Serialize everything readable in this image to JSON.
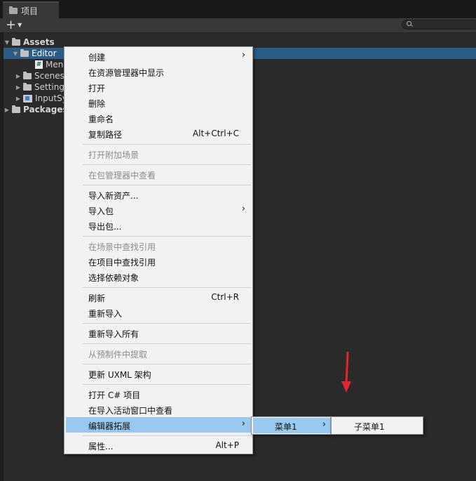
{
  "window": {
    "tab_label": "项目",
    "add_button": "+",
    "search_placeholder": ""
  },
  "tree": [
    {
      "label": "Assets",
      "expanded": true,
      "icon": "folder-icon"
    },
    {
      "label": "Editor",
      "expanded": true,
      "icon": "folder-open-icon",
      "selected": true
    },
    {
      "label": "Men",
      "icon": "csharp-script-icon"
    },
    {
      "label": "Scenes",
      "icon": "folder-icon"
    },
    {
      "label": "Setting",
      "icon": "folder-icon"
    },
    {
      "label": "InputSy",
      "icon": "input-settings-icon"
    },
    {
      "label": "Packages",
      "icon": "folder-icon"
    }
  ],
  "context_menu": {
    "items": [
      {
        "label": "创建",
        "submenu": true
      },
      {
        "label": "在资源管理器中显示"
      },
      {
        "label": "打开"
      },
      {
        "label": "删除"
      },
      {
        "label": "重命名"
      },
      {
        "label": "复制路径",
        "shortcut": "Alt+Ctrl+C"
      },
      {
        "label": "打开附加场景",
        "disabled": true
      },
      {
        "label": "在包管理器中查看",
        "disabled": true
      },
      {
        "label": "导入新资产..."
      },
      {
        "label": "导入包",
        "submenu": true
      },
      {
        "label": "导出包..."
      },
      {
        "label": "在场景中查找引用",
        "disabled": true
      },
      {
        "label": "在项目中查找引用"
      },
      {
        "label": "选择依赖对象"
      },
      {
        "label": "刷新",
        "shortcut": "Ctrl+R"
      },
      {
        "label": "重新导入"
      },
      {
        "label": "重新导入所有"
      },
      {
        "label": "从预制件中提取",
        "disabled": true
      },
      {
        "label": "更新 UXML 架构"
      },
      {
        "label": "打开 C# 项目"
      },
      {
        "label": "在导入活动窗口中查看"
      },
      {
        "label": "编辑器拓展",
        "submenu": true,
        "highlighted": true
      },
      {
        "label": "属性...",
        "shortcut": "Alt+P"
      }
    ],
    "submenu_chevron": "›"
  },
  "submenu_level1": {
    "label": "菜单1",
    "submenu": true
  },
  "submenu_level2": {
    "label": "子菜单1"
  },
  "colors": {
    "selection": "#2c5d87",
    "menu_highlight": "#99c9ef",
    "annotation_arrow": "#e3262d"
  }
}
